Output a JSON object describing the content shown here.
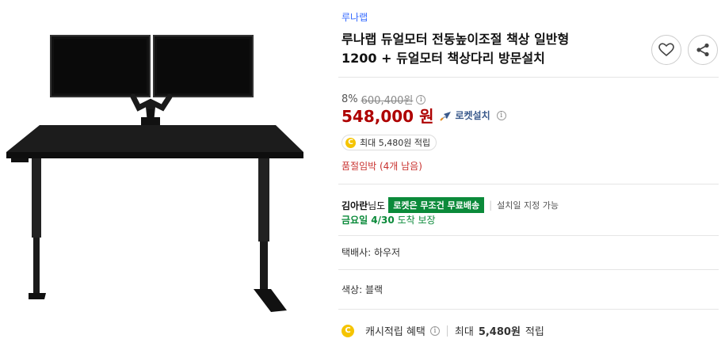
{
  "product": {
    "brand": "루나랩",
    "title_line1": "루나랩 듀얼모터 전동높이조절 책상 일반형",
    "title_line2": "1200 + 듀얼모터 책상다리 방문설치"
  },
  "price": {
    "discount": "8%",
    "original": "600,400원",
    "current": "548,000",
    "currency": "원",
    "rocket_label": "로켓설치"
  },
  "reward": {
    "label": "최대 5,480원 적립"
  },
  "stock": {
    "text": "품절임박 (4개 남음)"
  },
  "shipping": {
    "user": "김아란",
    "suffix": "님도",
    "badge": "로켓은 무조건 무료배송",
    "note": "설치일 지정 가능",
    "arrival_day": "금요일 4/30",
    "arrival_suffix": "도착 보장"
  },
  "courier": "택배사: 하우저",
  "color": "색상: 블랙",
  "cashback": {
    "label": "캐시적립 혜택",
    "amount_prefix": "최대",
    "amount": "5,480원",
    "amount_suffix": "적립"
  },
  "icons": {
    "coin_letter": "C",
    "info_letter": "i"
  },
  "colors": {
    "price": "#ae0000",
    "brand_link": "#346aff",
    "rocket_green": "#0b8a3a",
    "stock_red": "#c9322f",
    "coin": "#f5c400"
  }
}
